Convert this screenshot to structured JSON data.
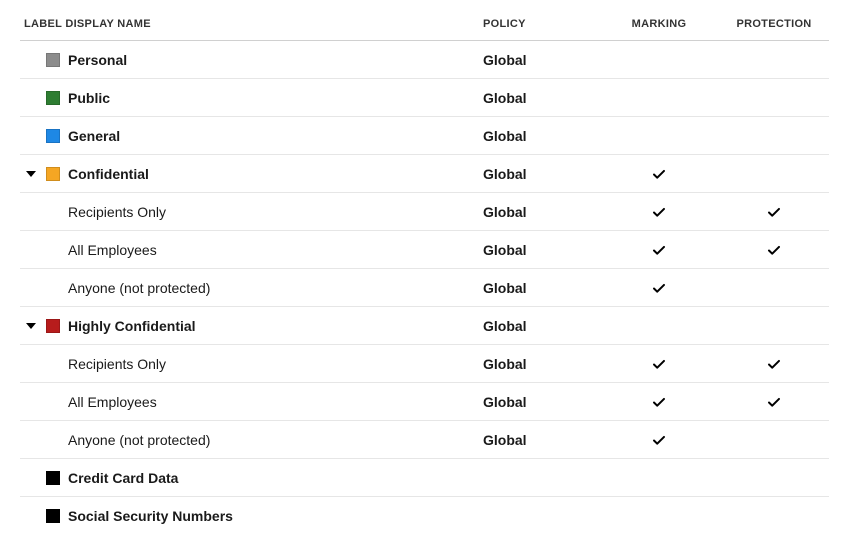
{
  "columns": {
    "name": "LABEL DISPLAY NAME",
    "policy": "POLICY",
    "marking": "MARKING",
    "protection": "PROTECTION"
  },
  "rows": [
    {
      "type": "top",
      "expanded": null,
      "color": "#8c8c8c",
      "name": "Personal",
      "policy": "Global",
      "marking": false,
      "protection": false
    },
    {
      "type": "top",
      "expanded": null,
      "color": "#2e7d32",
      "name": "Public",
      "policy": "Global",
      "marking": false,
      "protection": false
    },
    {
      "type": "top",
      "expanded": null,
      "color": "#1e88e5",
      "name": "General",
      "policy": "Global",
      "marking": false,
      "protection": false
    },
    {
      "type": "top",
      "expanded": true,
      "color": "#f5a623",
      "name": "Confidential",
      "policy": "Global",
      "marking": true,
      "protection": false
    },
    {
      "type": "sub",
      "name": "Recipients Only",
      "policy": "Global",
      "marking": true,
      "protection": true
    },
    {
      "type": "sub",
      "name": "All Employees",
      "policy": "Global",
      "marking": true,
      "protection": true
    },
    {
      "type": "sub",
      "name": "Anyone (not protected)",
      "policy": "Global",
      "marking": true,
      "protection": false
    },
    {
      "type": "top",
      "expanded": true,
      "color": "#b71c1c",
      "name": "Highly Confidential",
      "policy": "Global",
      "marking": false,
      "protection": false
    },
    {
      "type": "sub",
      "name": "Recipients Only",
      "policy": "Global",
      "marking": true,
      "protection": true
    },
    {
      "type": "sub",
      "name": "All Employees",
      "policy": "Global",
      "marking": true,
      "protection": true
    },
    {
      "type": "sub",
      "name": "Anyone (not protected)",
      "policy": "Global",
      "marking": true,
      "protection": false
    },
    {
      "type": "top",
      "expanded": null,
      "color": "#000000",
      "name": "Credit Card Data",
      "policy": "",
      "marking": false,
      "protection": false
    },
    {
      "type": "top",
      "expanded": null,
      "color": "#000000",
      "name": "Social Security Numbers",
      "policy": "",
      "marking": false,
      "protection": false
    }
  ]
}
